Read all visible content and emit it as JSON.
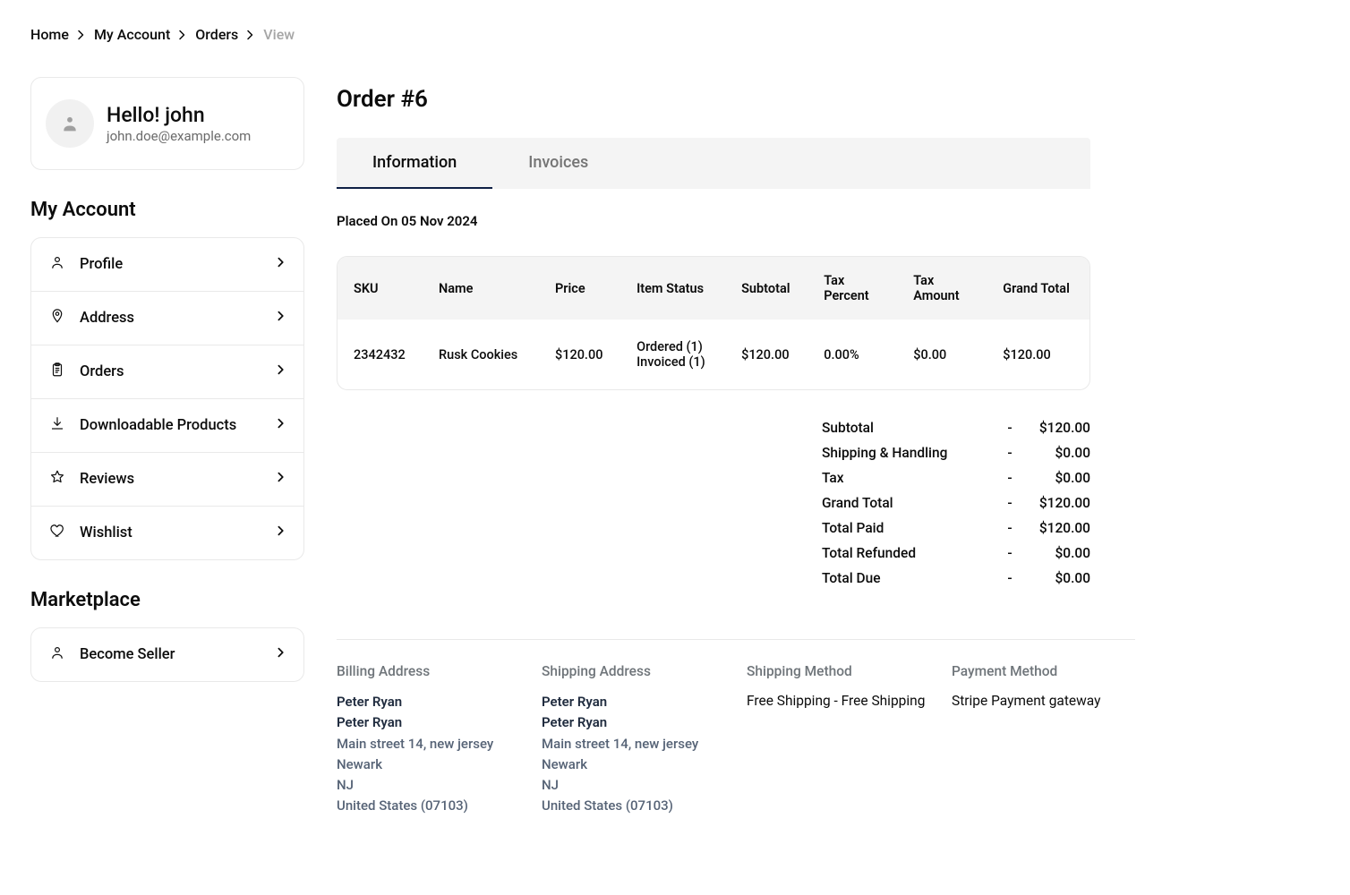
{
  "breadcrumbs": {
    "items": [
      {
        "label": "Home"
      },
      {
        "label": "My Account"
      },
      {
        "label": "Orders"
      }
    ],
    "current": "View"
  },
  "user": {
    "greeting": "Hello! john",
    "email": "john.doe@example.com"
  },
  "sidebar": {
    "accountTitle": "My Account",
    "marketplaceTitle": "Marketplace",
    "items": [
      {
        "label": "Profile"
      },
      {
        "label": "Address"
      },
      {
        "label": "Orders"
      },
      {
        "label": "Downloadable Products"
      },
      {
        "label": "Reviews"
      },
      {
        "label": "Wishlist"
      }
    ],
    "marketplaceItems": [
      {
        "label": "Become Seller"
      }
    ]
  },
  "order": {
    "title": "Order #6",
    "placedOn": "Placed On 05 Nov 2024",
    "tabs": {
      "information": "Information",
      "invoices": "Invoices"
    }
  },
  "itemsTable": {
    "headers": {
      "sku": "SKU",
      "name": "Name",
      "price": "Price",
      "itemStatus": "Item Status",
      "subtotal": "Subtotal",
      "taxPercent": "Tax Percent",
      "taxAmount": "Tax Amount",
      "grandTotal": "Grand Total"
    },
    "rows": [
      {
        "sku": "2342432",
        "name": "Rusk Cookies",
        "price": "$120.00",
        "statusLine1": "Ordered (1)",
        "statusLine2": "Invoiced (1)",
        "subtotal": "$120.00",
        "taxPercent": "0.00%",
        "taxAmount": "$0.00",
        "grandTotal": "$120.00"
      }
    ]
  },
  "totals": {
    "subtotal": {
      "label": "Subtotal",
      "value": "$120.00"
    },
    "shipping": {
      "label": "Shipping & Handling",
      "value": "$0.00"
    },
    "tax": {
      "label": "Tax",
      "value": "$0.00"
    },
    "grandTotal": {
      "label": "Grand Total",
      "value": "$120.00"
    },
    "totalPaid": {
      "label": "Total Paid",
      "value": "$120.00"
    },
    "totalRefunded": {
      "label": "Total Refunded",
      "value": "$0.00"
    },
    "totalDue": {
      "label": "Total Due",
      "value": "$0.00"
    }
  },
  "addresses": {
    "billing": {
      "title": "Billing Address",
      "name1": "Peter Ryan",
      "name2": "Peter Ryan",
      "street": "Main street 14, new jersey",
      "city": "Newark",
      "state": "NJ",
      "country": "United States (07103)"
    },
    "shipping": {
      "title": "Shipping Address",
      "name1": "Peter Ryan",
      "name2": "Peter Ryan",
      "street": "Main street 14, new jersey",
      "city": "Newark",
      "state": "NJ",
      "country": "United States (07103)"
    },
    "shippingMethod": {
      "title": "Shipping Method",
      "value": "Free Shipping - Free Shipping"
    },
    "paymentMethod": {
      "title": "Payment Method",
      "value": "Stripe Payment gateway"
    }
  }
}
